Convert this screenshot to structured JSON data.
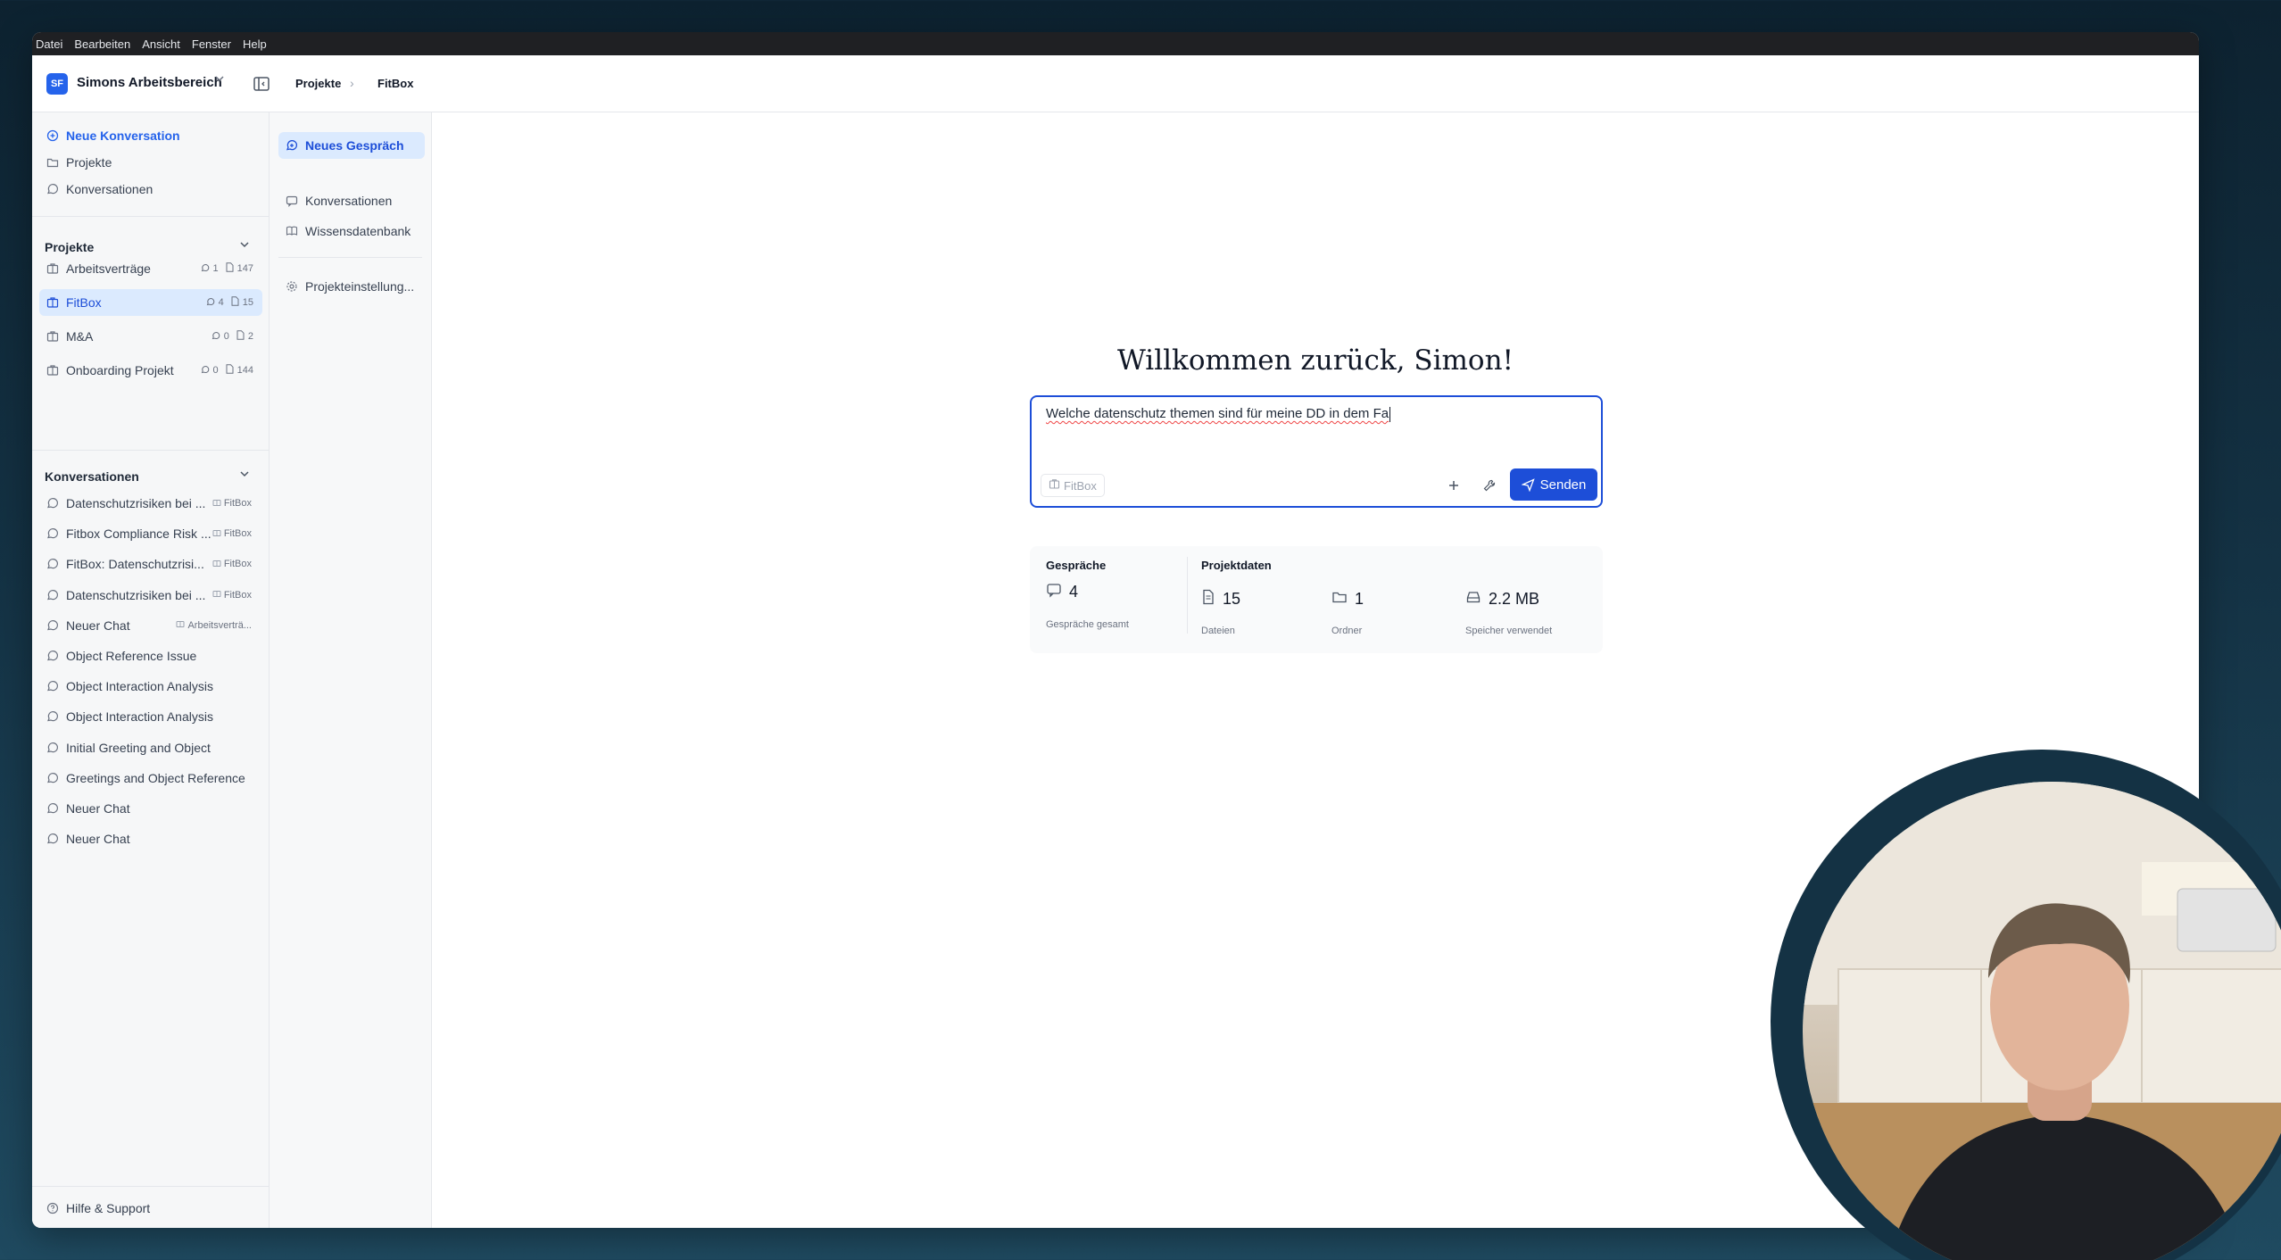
{
  "menubar": {
    "items": [
      "Datei",
      "Bearbeiten",
      "Ansicht",
      "Fenster",
      "Help"
    ]
  },
  "topbar": {
    "workspace_initials": "SF",
    "workspace_name": "Simons Arbeitsbereich",
    "breadcrumb": [
      "Projekte",
      "FitBox"
    ]
  },
  "sidebar": {
    "nav": [
      "Neue Konversation",
      "Projekte",
      "Konversationen"
    ],
    "projects_title": "Projekte",
    "projects": [
      {
        "name": "Arbeitsverträge",
        "chats": "1",
        "files": "147"
      },
      {
        "name": "FitBox",
        "chats": "4",
        "files": "15"
      },
      {
        "name": "M&A",
        "chats": "0",
        "files": "2"
      },
      {
        "name": "Onboarding Projekt",
        "chats": "0",
        "files": "144"
      }
    ],
    "conversations_title": "Konversationen",
    "conversations": [
      {
        "title": "Datenschutzrisiken bei ...",
        "tag": "FitBox"
      },
      {
        "title": "Fitbox Compliance Risk ...",
        "tag": "FitBox"
      },
      {
        "title": "FitBox: Datenschutzrisi...",
        "tag": "FitBox"
      },
      {
        "title": "Datenschutzrisiken bei ...",
        "tag": "FitBox"
      },
      {
        "title": "Neuer Chat",
        "tag": "Arbeitsverträ..."
      },
      {
        "title": "Object Reference Issue",
        "tag": ""
      },
      {
        "title": "Object Interaction Analysis",
        "tag": ""
      },
      {
        "title": "Object Interaction Analysis",
        "tag": ""
      },
      {
        "title": "Initial Greeting and Object",
        "tag": ""
      },
      {
        "title": "Greetings and Object Reference",
        "tag": ""
      },
      {
        "title": "Neuer Chat",
        "tag": ""
      },
      {
        "title": "Neuer Chat",
        "tag": ""
      }
    ],
    "help": "Hilfe & Support"
  },
  "subnav": {
    "new_chat": "Neues Gespräch",
    "items": [
      "Konversationen",
      "Wissensdatenbank",
      "Projekteinstellung..."
    ]
  },
  "main": {
    "welcome": "Willkommen zurück, Simon!",
    "composer": {
      "text": "Welche datenschutz themen sind für meine DD in dem Fa",
      "project_chip": "FitBox",
      "send_label": "Senden"
    },
    "stats": {
      "conversations_heading": "Gespräche",
      "conversations_value": "4",
      "conversations_label": "Gespräche gesamt",
      "project_heading": "Projektdaten",
      "files_value": "15",
      "files_label": "Dateien",
      "folders_value": "1",
      "folders_label": "Ordner",
      "storage_value": "2.2 MB",
      "storage_label": "Speicher verwendet"
    }
  },
  "colors": {
    "accent": "#1d4ed8",
    "selected_bg": "#dbeafe",
    "sidebar_bg": "#f6f7f8"
  }
}
